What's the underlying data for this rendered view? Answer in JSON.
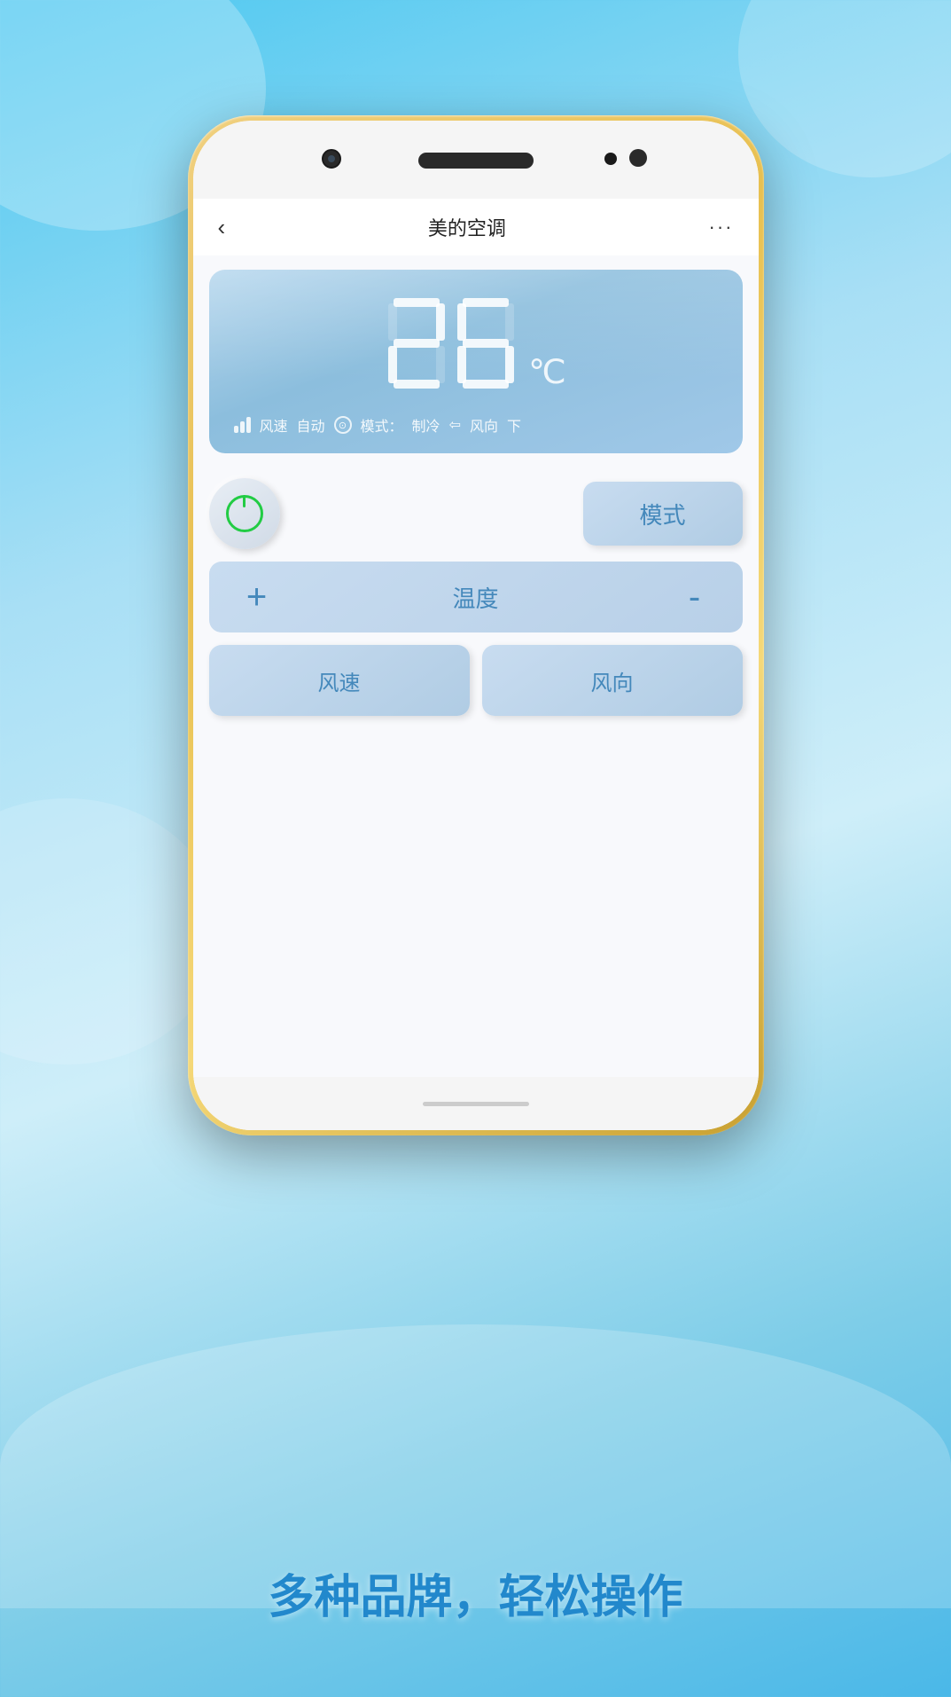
{
  "background": {
    "colors": [
      "#4ec8f0",
      "#a8dff5",
      "#ceeef9",
      "#7ecde8"
    ]
  },
  "phone": {
    "speaker": "speaker",
    "camera": "front-camera"
  },
  "nav": {
    "back_label": "‹",
    "title": "美的空调",
    "more_label": "···"
  },
  "display": {
    "temperature": "26",
    "unit": "℃",
    "wind_speed_label": "风速",
    "wind_speed_value": "自动",
    "mode_label": "模式：",
    "mode_value": "制冷",
    "wind_dir_label": "风向",
    "wind_dir_value": "下"
  },
  "controls": {
    "power_label": "电源",
    "mode_btn_label": "模式",
    "temp_plus_label": "+",
    "temp_label": "温度",
    "temp_minus_label": "-",
    "wind_speed_btn_label": "风速",
    "wind_dir_btn_label": "风向"
  },
  "slogan": {
    "text": "多种品牌，轻松操作"
  }
}
